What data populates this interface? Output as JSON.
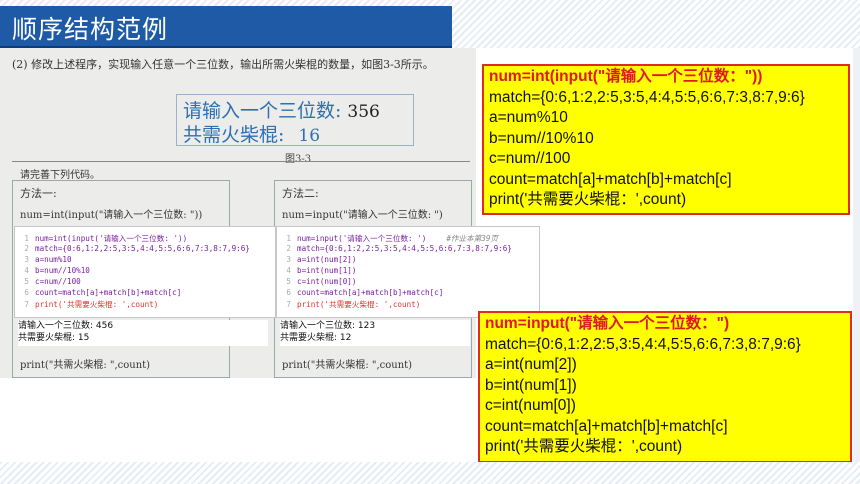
{
  "title": "顺序结构范例",
  "scan": {
    "question": "(2) 修改上述程序，实现输入任意一个三位数，输出所需火柴棍的数量，如图3-3所示。",
    "demo_line1": "请输入一个三位数:",
    "demo_value1": "356",
    "demo_line2": "共需火柴棍:",
    "demo_value2": "16",
    "figure_label": "图3-3",
    "prompt": "请完善下列代码。",
    "method1": {
      "label": "方法一:",
      "line1": "num=int(input(\"请输入一个三位数: \"))",
      "line_last": "print(\"共需火柴棍: \",count)"
    },
    "method2": {
      "label": "方法二:",
      "line1": "num=input(\"请输入一个三位数: \")",
      "line_last": "print(\"共需火柴棍: \",count)"
    }
  },
  "ide1": {
    "lines": [
      "num=int(input('请输入一个三位数: '))",
      "match={0:6,1:2,2:5,3:5,4:4,5:5,6:6,7:3,8:7,9:6}",
      "a=num%10",
      "b=num//10%10",
      "c=num//100",
      "count=match[a]+match[b]+match[c]",
      "print('共需要火柴棍: ',count)"
    ],
    "output": [
      "请输入一个三位数: 456",
      "共需要火柴棍:  15"
    ]
  },
  "ide2": {
    "lines": [
      "num=input('请输入一个三位数: ')",
      "match={0:6,1:2,2:5,3:5,4:4,5:5,6:6,7:3,8:7,9:6}",
      "a=int(num[2])",
      "b=int(num[1])",
      "c=int(num[0])",
      "count=match[a]+match[b]+match[c]",
      "print('共需要火柴棍: ',count)"
    ],
    "comment": "#作业本第39页",
    "output": [
      "请输入一个三位数: 123",
      "共需要火柴棍:  12"
    ]
  },
  "answer1": [
    "num=int(input(\"请输入一个三位数：\"))",
    "match={0:6,1:2,2:5,3:5,4:4,5:5,6:6,7:3,8:7,9:6}",
    "a=num%10",
    "b=num//10%10",
    "c=num//100",
    "count=match[a]+match[b]+match[c]",
    "print('共需要火柴棍：',count)"
  ],
  "answer2": [
    "num=input(\"请输入一个三位数：\")",
    "match={0:6,1:2,2:5,3:5,4:4,5:5,6:6,7:3,8:7,9:6}",
    "a=int(num[2])",
    "b=int(num[1])",
    "c=int(num[0])",
    "count=match[a]+match[b]+match[c]",
    "print('共需要火柴棍：',count)"
  ],
  "colors": {
    "title_bg": "#1f5aa6",
    "answer_bg": "#ffff00",
    "answer_border": "#e12b1f",
    "highlight_text": "#e0181f"
  }
}
